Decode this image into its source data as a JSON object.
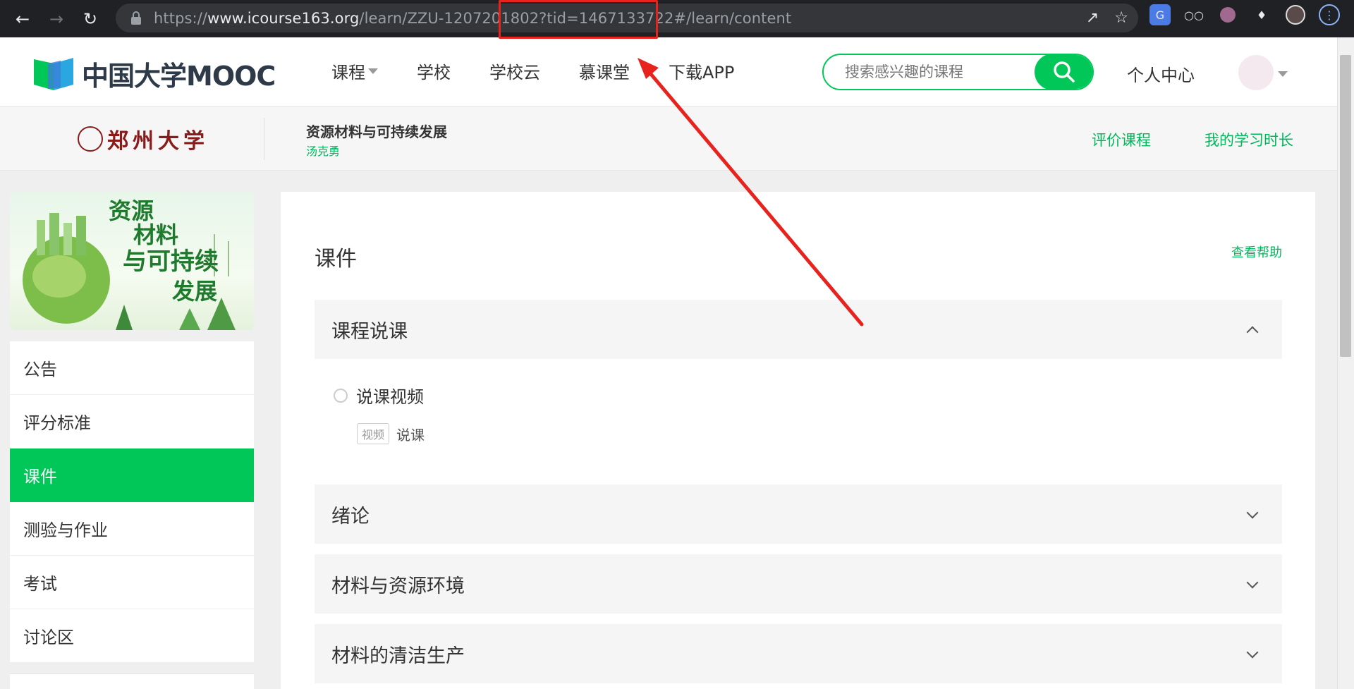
{
  "browser": {
    "url_prefix": "https://",
    "url_host": "www.icourse163.org",
    "url_path": "/learn/ZZU-1207201802?tid=1467133722#/learn/content"
  },
  "header": {
    "logo_text": "中国大学MOOC",
    "nav": [
      "课程",
      "学校",
      "学校云",
      "慕课堂",
      "下载APP"
    ],
    "search_placeholder": "搜索感兴趣的课程",
    "personal_center": "个人中心"
  },
  "course": {
    "school": "郑州大学",
    "title": "资源材料与可持续发展",
    "teacher": "汤克勇",
    "rate_label": "评价课程",
    "study_time_label": "我的学习时长"
  },
  "sidebar": {
    "cover_text": [
      "资源",
      "材料",
      "与可持续",
      "发展"
    ],
    "items": [
      "公告",
      "评分标准",
      "课件",
      "测验与作业",
      "考试",
      "讨论区"
    ],
    "active_index": 2
  },
  "content": {
    "title": "课件",
    "help": "查看帮助",
    "chapters": [
      {
        "title": "课程说课",
        "expanded": true
      },
      {
        "title": "绪论",
        "expanded": false
      },
      {
        "title": "材料与资源环境",
        "expanded": false
      },
      {
        "title": "材料的清洁生产",
        "expanded": false
      }
    ],
    "lesson_title": "说课视频",
    "unit_tag": "视频",
    "unit_label": "说课"
  },
  "colors": {
    "accent": "#00c758",
    "annotation": "#e8221c",
    "browser_bg": "#202124"
  }
}
